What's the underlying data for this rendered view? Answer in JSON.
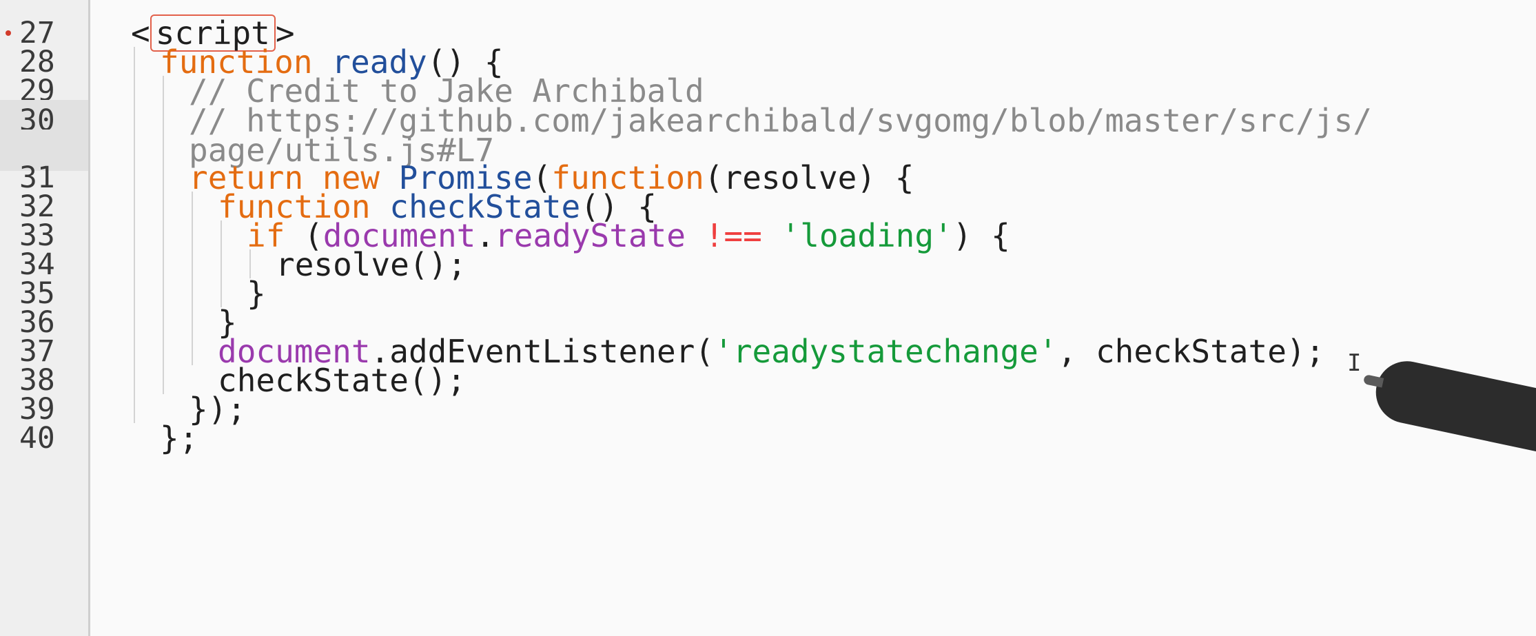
{
  "editor": {
    "active_line": "30",
    "breakpoint_line": "27",
    "lines": [
      {
        "number": "27",
        "tokens": [
          {
            "text": "<",
            "cls": "punc"
          },
          {
            "text": "script",
            "cls": "tag"
          },
          {
            "text": ">",
            "cls": "punc"
          }
        ]
      },
      {
        "number": "28",
        "tokens": [
          {
            "text": "function",
            "cls": "kw"
          },
          {
            "text": " ",
            "cls": "punc"
          },
          {
            "text": "ready",
            "cls": "fn"
          },
          {
            "text": "() {",
            "cls": "punc"
          }
        ]
      },
      {
        "number": "29",
        "tokens": [
          {
            "text": "// Credit to Jake Archibald",
            "cls": "cm"
          }
        ]
      },
      {
        "number": "30",
        "tokens": [
          {
            "text": "// https://github.com/jakearchibald/svgomg/blob/master/src/js/",
            "cls": "cm"
          }
        ]
      },
      {
        "number": "",
        "tokens": [
          {
            "text": "page/utils.js#L7",
            "cls": "cm"
          }
        ]
      },
      {
        "number": "31",
        "tokens": [
          {
            "text": "return",
            "cls": "kw"
          },
          {
            "text": " ",
            "cls": "punc"
          },
          {
            "text": "new",
            "cls": "kw"
          },
          {
            "text": " ",
            "cls": "punc"
          },
          {
            "text": "Promise",
            "cls": "fn"
          },
          {
            "text": "(",
            "cls": "punc"
          },
          {
            "text": "function",
            "cls": "kw"
          },
          {
            "text": "(resolve) {",
            "cls": "punc"
          }
        ]
      },
      {
        "number": "32",
        "tokens": [
          {
            "text": "function",
            "cls": "kw"
          },
          {
            "text": " ",
            "cls": "punc"
          },
          {
            "text": "checkState",
            "cls": "fn"
          },
          {
            "text": "() {",
            "cls": "punc"
          }
        ]
      },
      {
        "number": "33",
        "tokens": [
          {
            "text": "if",
            "cls": "kw"
          },
          {
            "text": " (",
            "cls": "punc"
          },
          {
            "text": "document",
            "cls": "obj"
          },
          {
            "text": ".",
            "cls": "punc"
          },
          {
            "text": "readyState",
            "cls": "obj"
          },
          {
            "text": " ",
            "cls": "punc"
          },
          {
            "text": "!==",
            "cls": "op"
          },
          {
            "text": " ",
            "cls": "punc"
          },
          {
            "text": "'loading'",
            "cls": "str"
          },
          {
            "text": ") {",
            "cls": "punc"
          }
        ]
      },
      {
        "number": "34",
        "tokens": [
          {
            "text": "resolve();",
            "cls": "punc"
          }
        ]
      },
      {
        "number": "35",
        "tokens": [
          {
            "text": "}",
            "cls": "punc"
          }
        ]
      },
      {
        "number": "36",
        "tokens": [
          {
            "text": "}",
            "cls": "punc"
          }
        ]
      },
      {
        "number": "37",
        "tokens": [
          {
            "text": "document",
            "cls": "obj"
          },
          {
            "text": ".addEventListener(",
            "cls": "punc"
          },
          {
            "text": "'readystatechange'",
            "cls": "str"
          },
          {
            "text": ", checkState);",
            "cls": "punc"
          }
        ]
      },
      {
        "number": "38",
        "tokens": [
          {
            "text": "checkState();",
            "cls": "punc"
          }
        ]
      },
      {
        "number": "39",
        "tokens": [
          {
            "text": "});",
            "cls": "punc"
          }
        ]
      },
      {
        "number": "40",
        "tokens": [
          {
            "text": "};",
            "cls": "punc"
          }
        ]
      }
    ]
  }
}
